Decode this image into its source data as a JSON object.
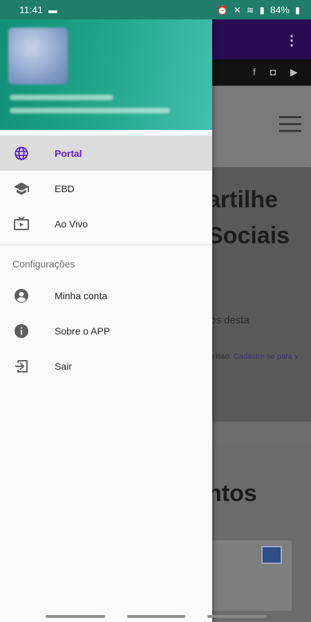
{
  "status_bar": {
    "time": "11:41",
    "battery": "84%"
  },
  "background_page": {
    "heading_1": "artilhe",
    "heading_2": "Sociais",
    "body_text": "tos desta",
    "small_text": "m isso.",
    "signup_link": "Cadastre-se para v",
    "section_heading": "ntos"
  },
  "drawer": {
    "items": [
      {
        "label": "Portal",
        "icon": "globe-icon",
        "active": true
      },
      {
        "label": "EBD",
        "icon": "school-icon",
        "active": false
      },
      {
        "label": "Ao Vivo",
        "icon": "live-tv-icon",
        "active": false
      }
    ],
    "settings_title": "Configurações",
    "settings_items": [
      {
        "label": "Minha conta",
        "icon": "account-circle-icon"
      },
      {
        "label": "Sobre o APP",
        "icon": "info-icon"
      },
      {
        "label": "Sair",
        "icon": "logout-icon"
      }
    ]
  },
  "colors": {
    "header_teal": "#1a9a80",
    "active_accent": "#5b22c9",
    "toolbar_purple": "#2a0b52"
  }
}
